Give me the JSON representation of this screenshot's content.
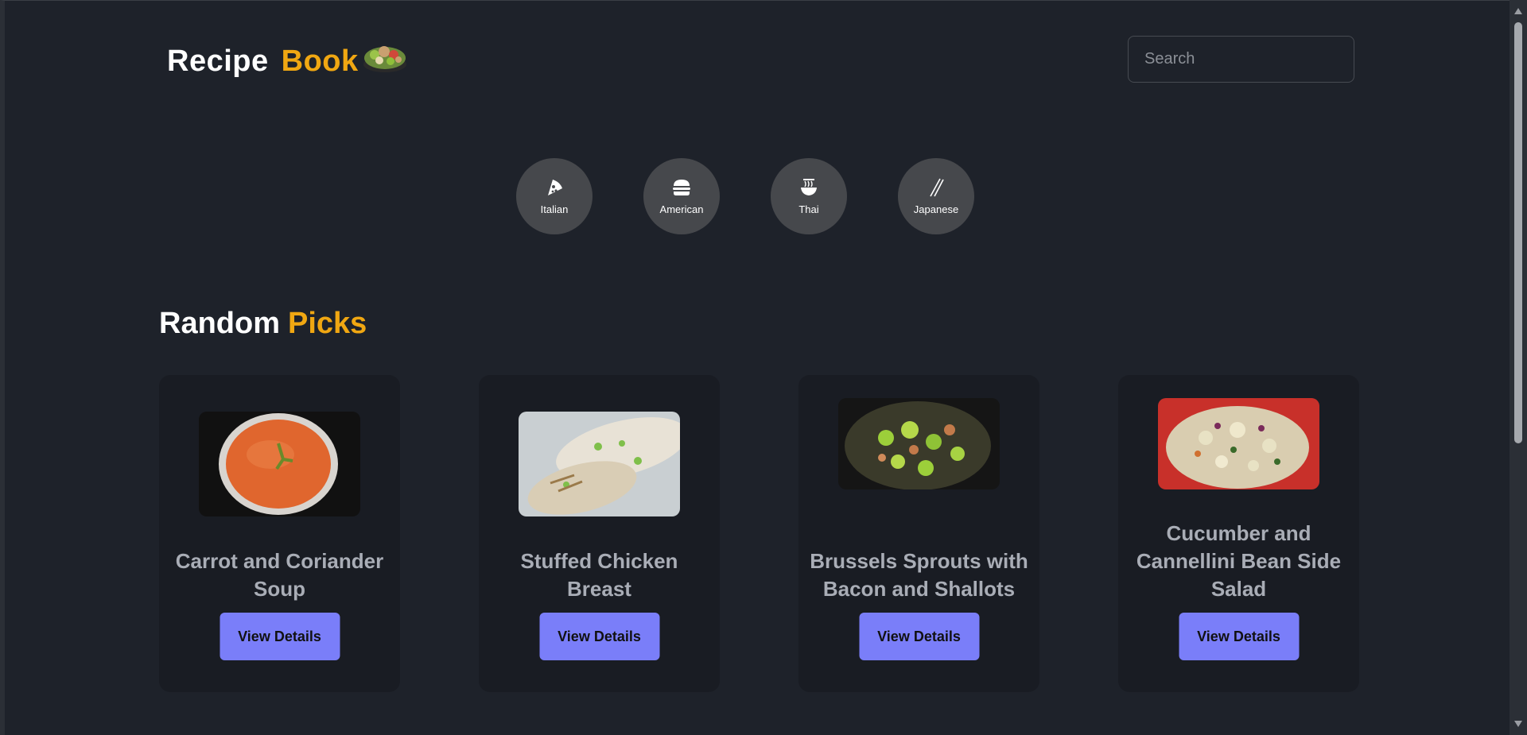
{
  "header": {
    "logo_word1": "Recipe",
    "logo_word2": "Book",
    "logo_icon": "salad-bowl-icon",
    "search_placeholder": "Search"
  },
  "categories": [
    {
      "label": "Italian",
      "icon": "pizza-icon"
    },
    {
      "label": "American",
      "icon": "burger-icon"
    },
    {
      "label": "Thai",
      "icon": "noodle-bowl-icon"
    },
    {
      "label": "Japanese",
      "icon": "chopsticks-icon"
    }
  ],
  "section": {
    "title_word1": "Random",
    "title_word2": "Picks"
  },
  "cards": [
    {
      "title": "Carrot and Coriander Soup",
      "button": "View Details"
    },
    {
      "title": "Stuffed Chicken Breast",
      "button": "View Details"
    },
    {
      "title": "Brussels Sprouts with Bacon and Shallots",
      "button": "View Details"
    },
    {
      "title": "Cucumber and Cannellini Bean Side Salad",
      "button": "View Details"
    }
  ],
  "colors": {
    "background": "#1e222a",
    "accent": "#f0a712",
    "button": "#7a7ef9",
    "card": "#191c23",
    "category_circle": "#46484c"
  }
}
